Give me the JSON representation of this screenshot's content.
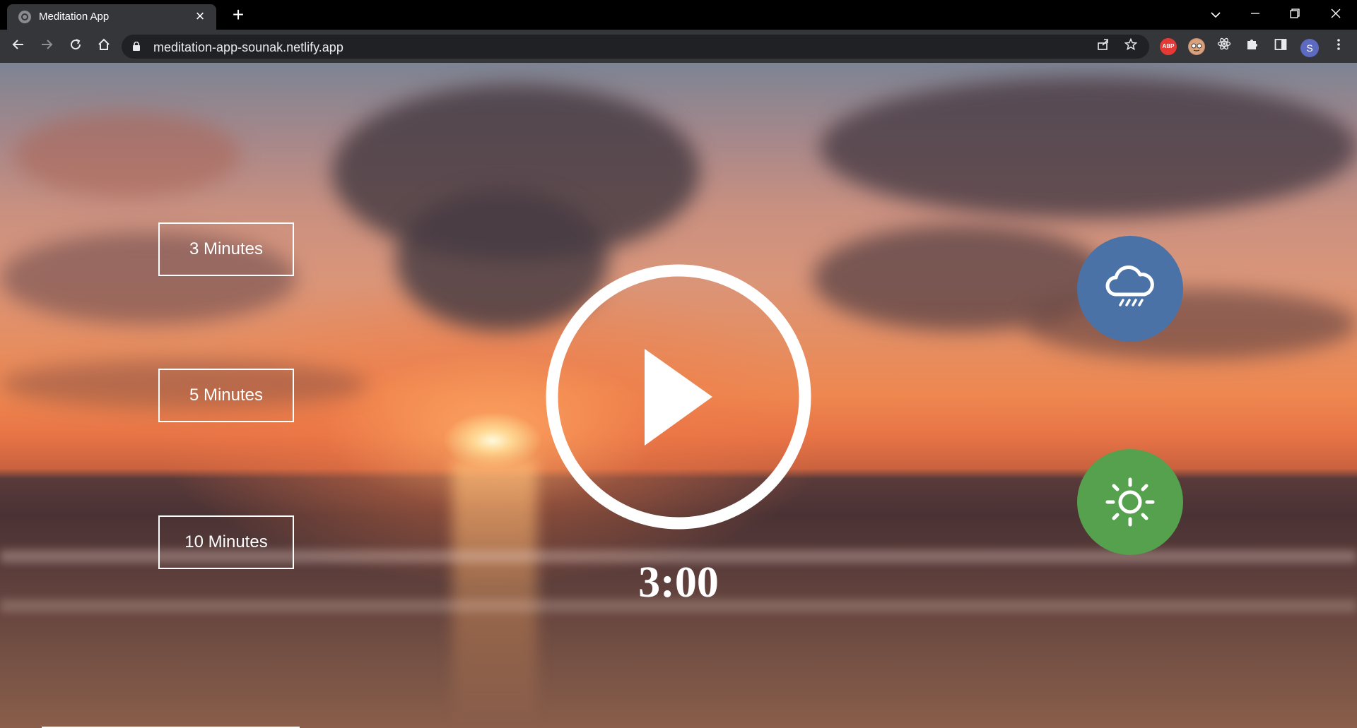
{
  "browser": {
    "tab_title": "Meditation App",
    "tab_close": "×",
    "new_tab": "+",
    "url": "meditation-app-sounak.netlify.app",
    "profile_initial": "S",
    "extensions": [
      "abp-icon",
      "face-icon",
      "react-icon",
      "puzzle-icon"
    ],
    "abp_label": "ABP",
    "window_controls": {
      "minimize": "—",
      "restore": "❐",
      "close": "✕",
      "tab_search": "⌄"
    }
  },
  "app": {
    "time_options": [
      {
        "label": "3 Minutes"
      },
      {
        "label": "5 Minutes"
      },
      {
        "label": "10 Minutes"
      }
    ],
    "timer": "3:00",
    "play_icon": "play-icon",
    "sounds": [
      {
        "name": "rain",
        "icon": "cloud-rain-icon",
        "color": "#4a72a6"
      },
      {
        "name": "beach",
        "icon": "sun-icon",
        "color": "#56a14e"
      }
    ],
    "progress_fraction": 0.19
  }
}
